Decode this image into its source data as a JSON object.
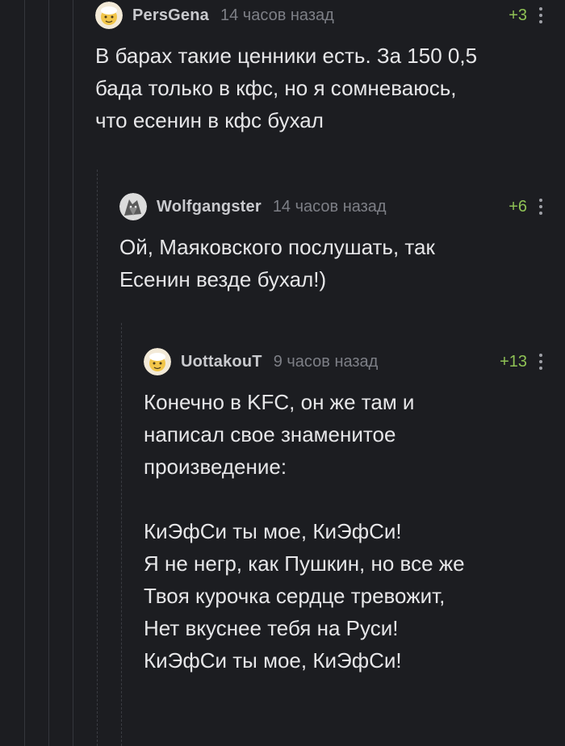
{
  "comments": [
    {
      "username": "PersGena",
      "time": "14 часов назад",
      "rating": "+3",
      "text": "В барах такие ценники есть. За 150 0,5\nбада только в кфс, но я сомневаюсь,\nчто есенин в кфс бухал"
    },
    {
      "username": "Wolfgangster",
      "time": "14 часов назад",
      "rating": "+6",
      "text": "Ой, Маяковского послушать, так\nЕсенин везде бухал!)"
    },
    {
      "username": "UottakouT",
      "time": "9 часов назад",
      "rating": "+13",
      "text": "Конечно в KFC, он же там и\nнаписал свое знаменитое\nпроизведение:\n\nКиЭфСи ты мое, КиЭфСи!\nЯ не негр, как Пушкин, но все же\nТвоя курочка сердце тревожит,\nНет вкуснее тебя на Руси!\nКиЭфСи ты мое, КиЭфСи!"
    }
  ],
  "colors": {
    "background": "#1c1d21",
    "rating": "#8fc255",
    "username": "#c9cace",
    "timestamp": "#7d7f86"
  }
}
